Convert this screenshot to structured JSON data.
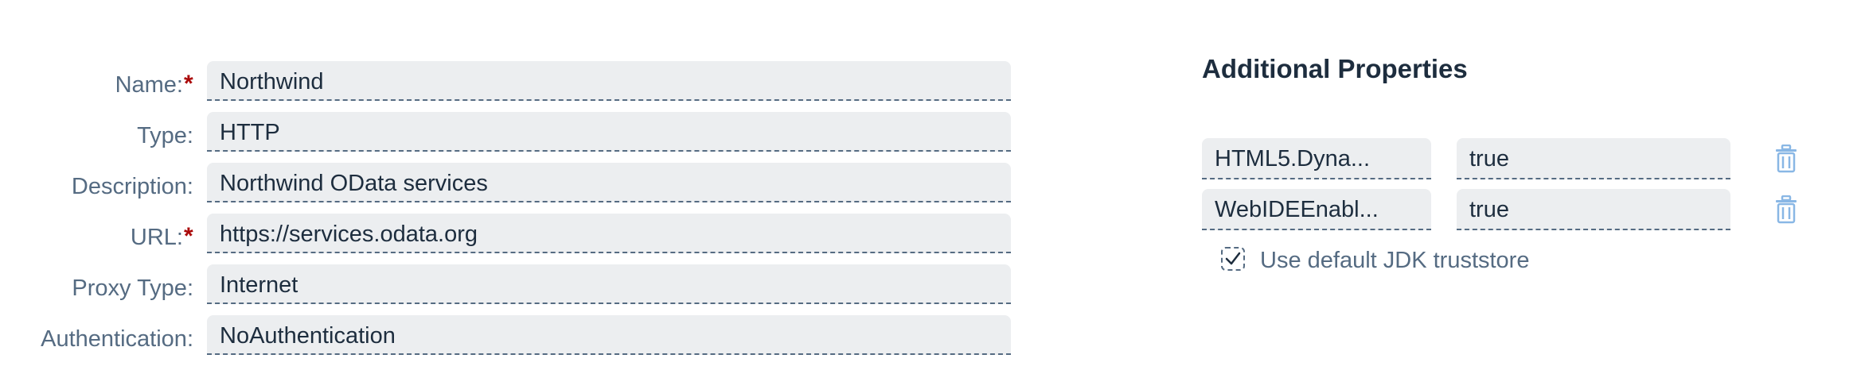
{
  "form": {
    "fields": [
      {
        "label": "Name:",
        "required": true,
        "value": "Northwind"
      },
      {
        "label": "Type:",
        "required": false,
        "value": "HTTP"
      },
      {
        "label": "Description:",
        "required": false,
        "value": "Northwind OData services"
      },
      {
        "label": "URL:",
        "required": true,
        "value": "https://services.odata.org"
      },
      {
        "label": "Proxy Type:",
        "required": false,
        "value": "Internet"
      },
      {
        "label": "Authentication:",
        "required": false,
        "value": "NoAuthentication"
      }
    ],
    "required_marker": "*"
  },
  "additional_properties": {
    "title": "Additional Properties",
    "rows": [
      {
        "key": "HTML5.Dyna...",
        "value": "true",
        "icon": "trash-icon"
      },
      {
        "key": "WebIDEEnabl...",
        "value": "true",
        "icon": "trash-icon"
      }
    ],
    "checkbox": {
      "label": "Use default JDK truststore",
      "checked": true
    }
  },
  "colors": {
    "label": "#556b82",
    "required": "#aa0808",
    "field_bg": "#eceef0",
    "text": "#1d2d3e",
    "icon": "#89b7e5"
  }
}
